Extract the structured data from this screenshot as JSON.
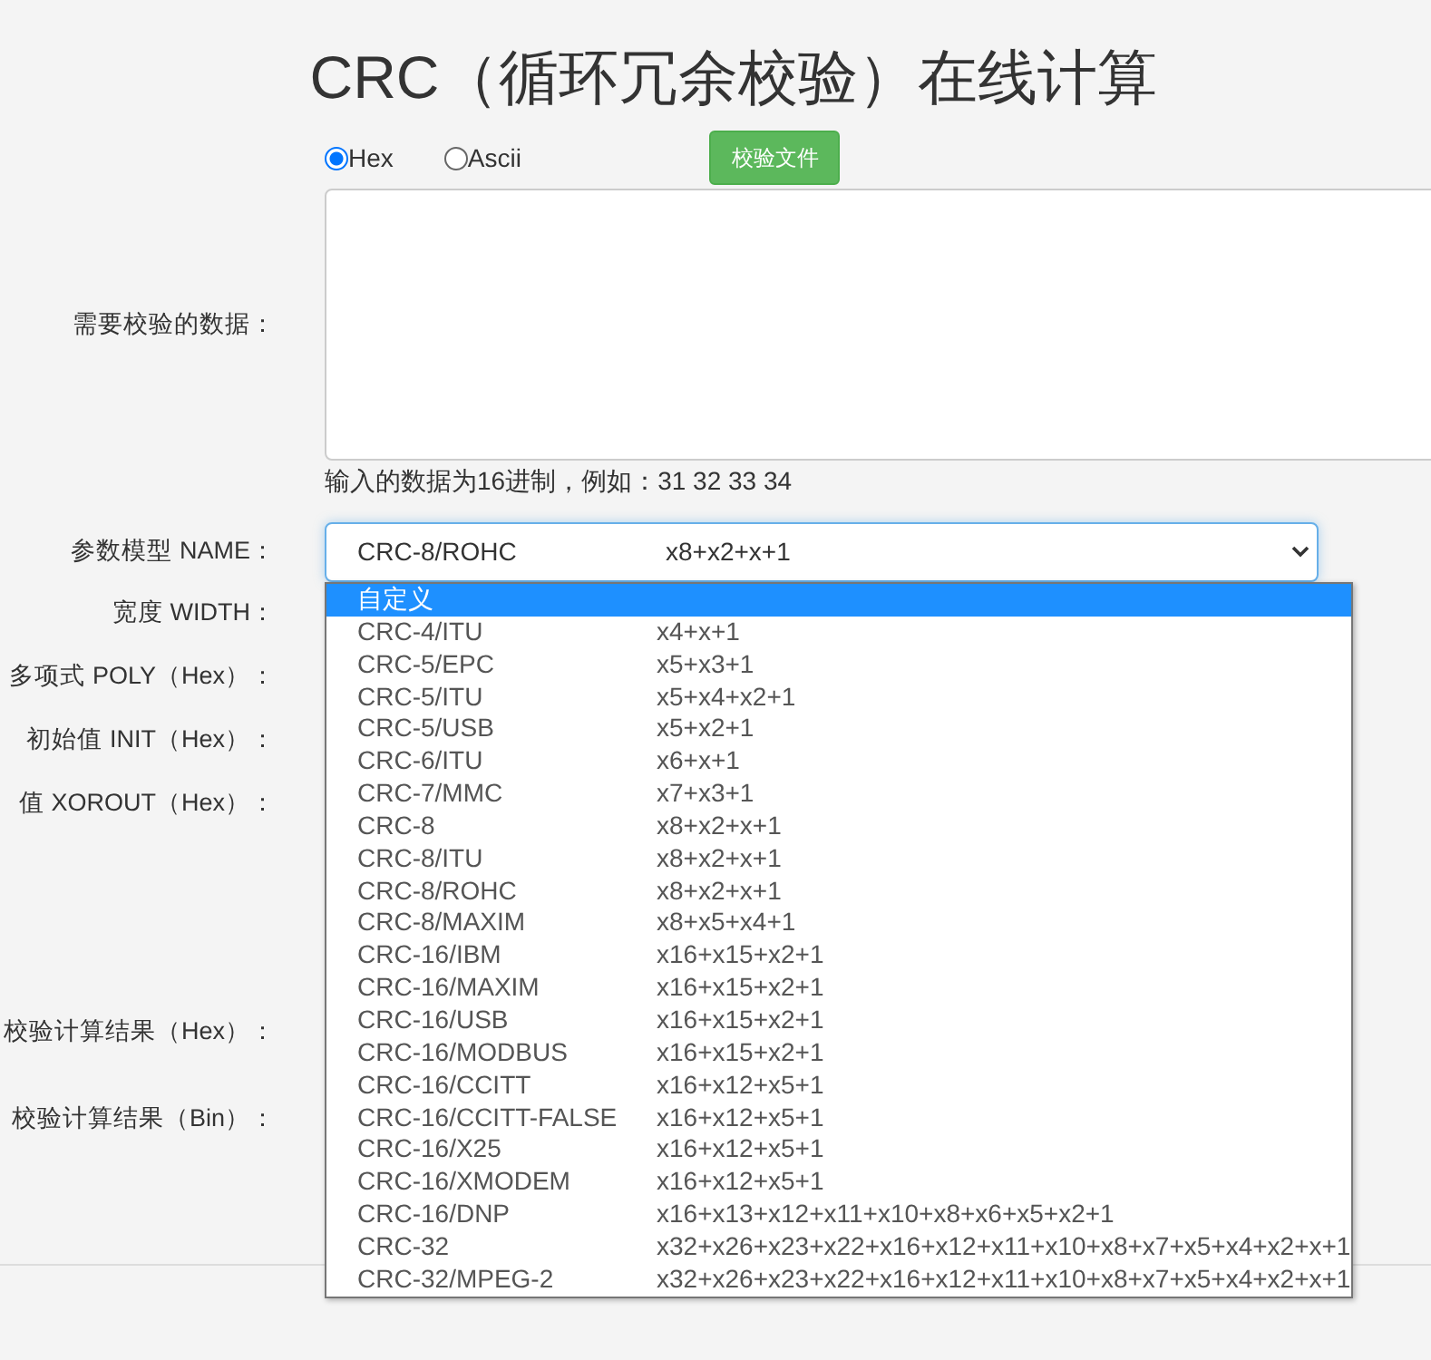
{
  "title": "CRC（循环冗余校验）在线计算",
  "format_options": [
    {
      "label": "Hex",
      "selected": true
    },
    {
      "label": "Ascii",
      "selected": false
    }
  ],
  "check_file_button": "校验文件",
  "data_label": "需要校验的数据：",
  "data_hint": "输入的数据为16进制，例如：31 32 33 34",
  "model_label": "参数模型 NAME：",
  "model_select": {
    "name": "CRC-8/ROHC",
    "poly": "x8+x2+x+1",
    "expanded": true
  },
  "model_options": [
    {
      "name": "自定义",
      "highlighted": true
    },
    {
      "name": "CRC-4/ITU",
      "poly": "x4+x+1",
      "highlighted": false
    },
    {
      "name": "CRC-5/EPC",
      "poly": "x5+x3+1",
      "highlighted": false
    },
    {
      "name": "CRC-5/ITU",
      "poly": "x5+x4+x2+1",
      "highlighted": false
    },
    {
      "name": "CRC-5/USB",
      "poly": "x5+x2+1",
      "highlighted": false
    },
    {
      "name": "CRC-6/ITU",
      "poly": "x6+x+1",
      "highlighted": false
    },
    {
      "name": "CRC-7/MMC",
      "poly": "x7+x3+1",
      "highlighted": false
    },
    {
      "name": "CRC-8",
      "poly": "x8+x2+x+1",
      "highlighted": false
    },
    {
      "name": "CRC-8/ITU",
      "poly": "x8+x2+x+1",
      "highlighted": false
    },
    {
      "name": "CRC-8/ROHC",
      "poly": "x8+x2+x+1",
      "highlighted": false
    },
    {
      "name": "CRC-8/MAXIM",
      "poly": "x8+x5+x4+1",
      "highlighted": false
    },
    {
      "name": "CRC-16/IBM",
      "poly": "x16+x15+x2+1",
      "highlighted": false
    },
    {
      "name": "CRC-16/MAXIM",
      "poly": "x16+x15+x2+1",
      "highlighted": false
    },
    {
      "name": "CRC-16/USB",
      "poly": "x16+x15+x2+1",
      "highlighted": false
    },
    {
      "name": "CRC-16/MODBUS",
      "poly": "x16+x15+x2+1",
      "highlighted": false
    },
    {
      "name": "CRC-16/CCITT",
      "poly": "x16+x12+x5+1",
      "highlighted": false
    },
    {
      "name": "CRC-16/CCITT-FALSE",
      "poly": "x16+x12+x5+1",
      "highlighted": false
    },
    {
      "name": "CRC-16/X25",
      "poly": "x16+x12+x5+1",
      "highlighted": false
    },
    {
      "name": "CRC-16/XMODEM",
      "poly": "x16+x12+x5+1",
      "highlighted": false
    },
    {
      "name": "CRC-16/DNP",
      "poly": "x16+x13+x12+x11+x10+x8+x6+x5+x2+1",
      "highlighted": false
    },
    {
      "name": "CRC-32",
      "poly": "x32+x26+x23+x22+x16+x12+x11+x10+x8+x7+x5+x4+x2+x+1",
      "highlighted": false
    },
    {
      "name": "CRC-32/MPEG-2",
      "poly": "x32+x26+x23+x22+x16+x12+x11+x10+x8+x7+x5+x4+x2+x+1",
      "highlighted": false
    }
  ],
  "param_labels": [
    "宽度 WIDTH：",
    "多项式 POLY（Hex）：",
    "初始值 INIT（Hex）：",
    "值 XOROUT（Hex）："
  ],
  "result_labels": [
    "校验计算结果（Hex）：",
    "校验计算结果（Bin）："
  ]
}
